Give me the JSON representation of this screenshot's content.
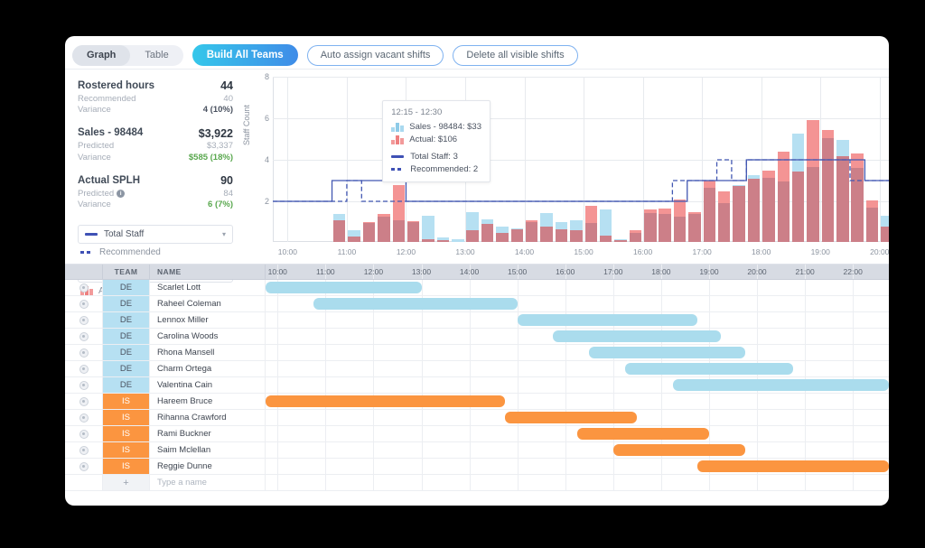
{
  "toolbar": {
    "view_tabs": [
      {
        "label": "Graph",
        "active": true
      },
      {
        "label": "Table",
        "active": false
      }
    ],
    "build_all_teams": "Build All Teams",
    "auto_assign": "Auto assign vacant shifts",
    "delete_all": "Delete all visible shifts"
  },
  "stats": [
    {
      "title": "Rostered hours",
      "value": "44",
      "sub_label": "Recommended",
      "sub_value": "40",
      "var_label": "Variance",
      "var_value": "4 (10%)",
      "var_positive": false,
      "has_info": false
    },
    {
      "title": "Sales - 98484",
      "value": "$3,922",
      "sub_label": "Predicted",
      "sub_value": "$3,337",
      "var_label": "Variance",
      "var_value": "$585 (18%)",
      "var_positive": true,
      "has_info": false
    },
    {
      "title": "Actual SPLH",
      "value": "90",
      "sub_label": "Predicted",
      "sub_value": "84",
      "var_label": "Variance",
      "var_value": "6 (7%)",
      "var_positive": true,
      "has_info": true,
      "info_icon": "info-icon"
    }
  ],
  "legend": {
    "staff_select": "Total Staff",
    "staff_recommended": "Recommended",
    "sales_select": "Sales - 98484",
    "sales_actual": "Actual",
    "caret_icon": "chevron-down-icon"
  },
  "tooltip": {
    "time_range": "12:15 - 12:30",
    "rows": [
      {
        "swatch": "bars-blue",
        "text": "Sales - 98484:  $33"
      },
      {
        "swatch": "bars-red",
        "text": "Actual:  $106"
      },
      {
        "swatch": "line-solid",
        "text": "Total Staff:  3"
      },
      {
        "swatch": "line-dashed",
        "text": "Recommended:  2"
      }
    ]
  },
  "chart_data": {
    "type": "bar",
    "title": "",
    "xlabel": "",
    "ylabel": "Staff Count",
    "ylim": [
      0,
      8
    ],
    "yticks": [
      2,
      4,
      6,
      8
    ],
    "grid": true,
    "legend_position": "left-panel",
    "xticks": [
      "10:00",
      "11:00",
      "12:00",
      "13:00",
      "14:00",
      "15:00",
      "16:00",
      "17:00",
      "18:00",
      "19:00",
      "20:00",
      "21:00",
      "22:00"
    ],
    "x_start": "09:45",
    "x_end": "22:45",
    "interval_minutes": 15,
    "x": [
      "09:45",
      "10:00",
      "10:15",
      "10:30",
      "10:45",
      "11:00",
      "11:15",
      "11:30",
      "11:45",
      "12:00",
      "12:15",
      "12:30",
      "12:45",
      "13:00",
      "13:15",
      "13:30",
      "13:45",
      "14:00",
      "14:15",
      "14:30",
      "14:45",
      "15:00",
      "15:15",
      "15:30",
      "15:45",
      "16:00",
      "16:15",
      "16:30",
      "16:45",
      "17:00",
      "17:15",
      "17:30",
      "17:45",
      "18:00",
      "18:15",
      "18:30",
      "18:45",
      "19:00",
      "19:15",
      "19:30",
      "19:45",
      "20:00",
      "20:15",
      "20:30",
      "20:45",
      "21:00",
      "21:15",
      "21:30",
      "21:45",
      "22:00",
      "22:15",
      "22:30"
    ],
    "series": [
      {
        "name": "Sales - 98484",
        "type": "bar",
        "color": "#b6e0f2",
        "values": [
          0,
          0,
          0,
          0,
          1.35,
          0.55,
          0.9,
          1.2,
          1.05,
          0.95,
          1.25,
          0.2,
          0.15,
          1.45,
          1.1,
          0.75,
          0.65,
          0.95,
          1.4,
          0.95,
          1.05,
          0.9,
          1.55,
          0.15,
          0.45,
          1.4,
          1.35,
          1.2,
          1.35,
          2.6,
          1.85,
          2.75,
          3.2,
          3.1,
          2.9,
          5.2,
          3.6,
          5.0,
          4.9,
          3.55,
          1.65,
          1.25,
          1.75,
          1.4,
          1.3,
          1.35,
          2.1,
          1.45,
          1.55,
          0.5,
          0.65,
          0.3
        ]
      },
      {
        "name": "Actual",
        "type": "bar",
        "color": "#f49494",
        "values": [
          0,
          0,
          0,
          0,
          1.05,
          0.25,
          0.95,
          1.35,
          2.75,
          1.0,
          0.15,
          0.1,
          0.0,
          0.55,
          0.85,
          0.45,
          0.6,
          1.05,
          0.75,
          0.6,
          0.55,
          1.75,
          0.3,
          0.1,
          0.55,
          1.55,
          1.6,
          2.05,
          1.45,
          2.95,
          2.45,
          2.7,
          3.05,
          3.45,
          4.35,
          3.4,
          5.85,
          5.4,
          4.15,
          4.25,
          2.0,
          0.75,
          1.6,
          1.15,
          0.85,
          1.5,
          2.9,
          1.35,
          1.75,
          0.3,
          0.55,
          0.5
        ]
      },
      {
        "name": "Total Staff",
        "type": "step-line",
        "style": "solid",
        "color": "#4257b2",
        "values": [
          2,
          2,
          2,
          2,
          3,
          3,
          3,
          3,
          3,
          2,
          2,
          2,
          2,
          2,
          2,
          2,
          2,
          2,
          2,
          2,
          2,
          2,
          2,
          2,
          2,
          2,
          2,
          2,
          3,
          3,
          3,
          3,
          4,
          4,
          4,
          4,
          4,
          4,
          4,
          4,
          3,
          3,
          3,
          3,
          3,
          3,
          3,
          3,
          3,
          2,
          2,
          2
        ]
      },
      {
        "name": "Recommended",
        "type": "step-line",
        "style": "dashed",
        "color": "#4257b2",
        "values": [
          2,
          2,
          2,
          2,
          2,
          3,
          2,
          2,
          2,
          2,
          2,
          2,
          2,
          2,
          2,
          2,
          2,
          2,
          2,
          2,
          2,
          2,
          2,
          2,
          2,
          2,
          2,
          3,
          3,
          3,
          4,
          3,
          4,
          4,
          4,
          4,
          4,
          4,
          4,
          3,
          3,
          3,
          3,
          3,
          3,
          3,
          3,
          4,
          3,
          2,
          2,
          2
        ]
      }
    ]
  },
  "gantt": {
    "columns": {
      "team": "TEAM",
      "name": "NAME"
    },
    "add_row": {
      "plus": "+",
      "placeholder": "Type a name"
    },
    "rows": [
      {
        "team": "DE",
        "name": "Scarlet Lott",
        "start": 9.75,
        "end": 13.0
      },
      {
        "team": "DE",
        "name": "Raheel Coleman",
        "start": 10.75,
        "end": 15.0
      },
      {
        "team": "DE",
        "name": "Lennox Miller",
        "start": 15.0,
        "end": 18.75
      },
      {
        "team": "DE",
        "name": "Carolina Woods",
        "start": 15.75,
        "end": 19.25
      },
      {
        "team": "DE",
        "name": "Rhona Mansell",
        "start": 16.5,
        "end": 19.75
      },
      {
        "team": "DE",
        "name": "Charm Ortega",
        "start": 17.25,
        "end": 20.75
      },
      {
        "team": "DE",
        "name": "Valentina Cain",
        "start": 18.25,
        "end": 22.75
      },
      {
        "team": "IS",
        "name": "Hareem Bruce",
        "start": 9.75,
        "end": 14.75
      },
      {
        "team": "IS",
        "name": "Rihanna Crawford",
        "start": 14.75,
        "end": 17.5
      },
      {
        "team": "IS",
        "name": "Rami Buckner",
        "start": 16.25,
        "end": 19.0
      },
      {
        "team": "IS",
        "name": "Saim Mclellan",
        "start": 17.0,
        "end": 19.75
      },
      {
        "team": "IS",
        "name": "Reggie Dunne",
        "start": 18.75,
        "end": 22.75
      }
    ]
  },
  "colors": {
    "team_de": "#b6e0f2",
    "team_is": "#fb9540",
    "sales_bar": "#b6e0f2",
    "actual_bar": "#f49494",
    "line": "#4257b2",
    "accent": "#3f8ce8",
    "positive": "#5aa84f"
  }
}
